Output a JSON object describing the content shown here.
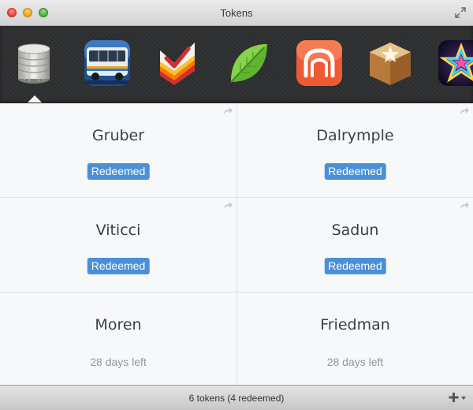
{
  "window": {
    "title": "Tokens"
  },
  "apps": [
    {
      "icon": "database-icon"
    },
    {
      "icon": "bus-icon"
    },
    {
      "icon": "checkmark-app-icon"
    },
    {
      "icon": "leaf-icon"
    },
    {
      "icon": "arch-icon"
    },
    {
      "icon": "box-icon"
    },
    {
      "icon": "star-icon"
    }
  ],
  "tokens": [
    {
      "name": "Gruber",
      "status": "Redeemed"
    },
    {
      "name": "Dalrymple",
      "status": "Redeemed"
    },
    {
      "name": "Viticci",
      "status": "Redeemed"
    },
    {
      "name": "Sadun",
      "status": "Redeemed"
    },
    {
      "name": "Moren",
      "status": "28 days left"
    },
    {
      "name": "Friedman",
      "status": "28 days left"
    }
  ],
  "status_bar": {
    "text": "6 tokens (4 redeemed)"
  },
  "colors": {
    "accent": "#4a90d9",
    "appbar": "#2e2f31"
  }
}
